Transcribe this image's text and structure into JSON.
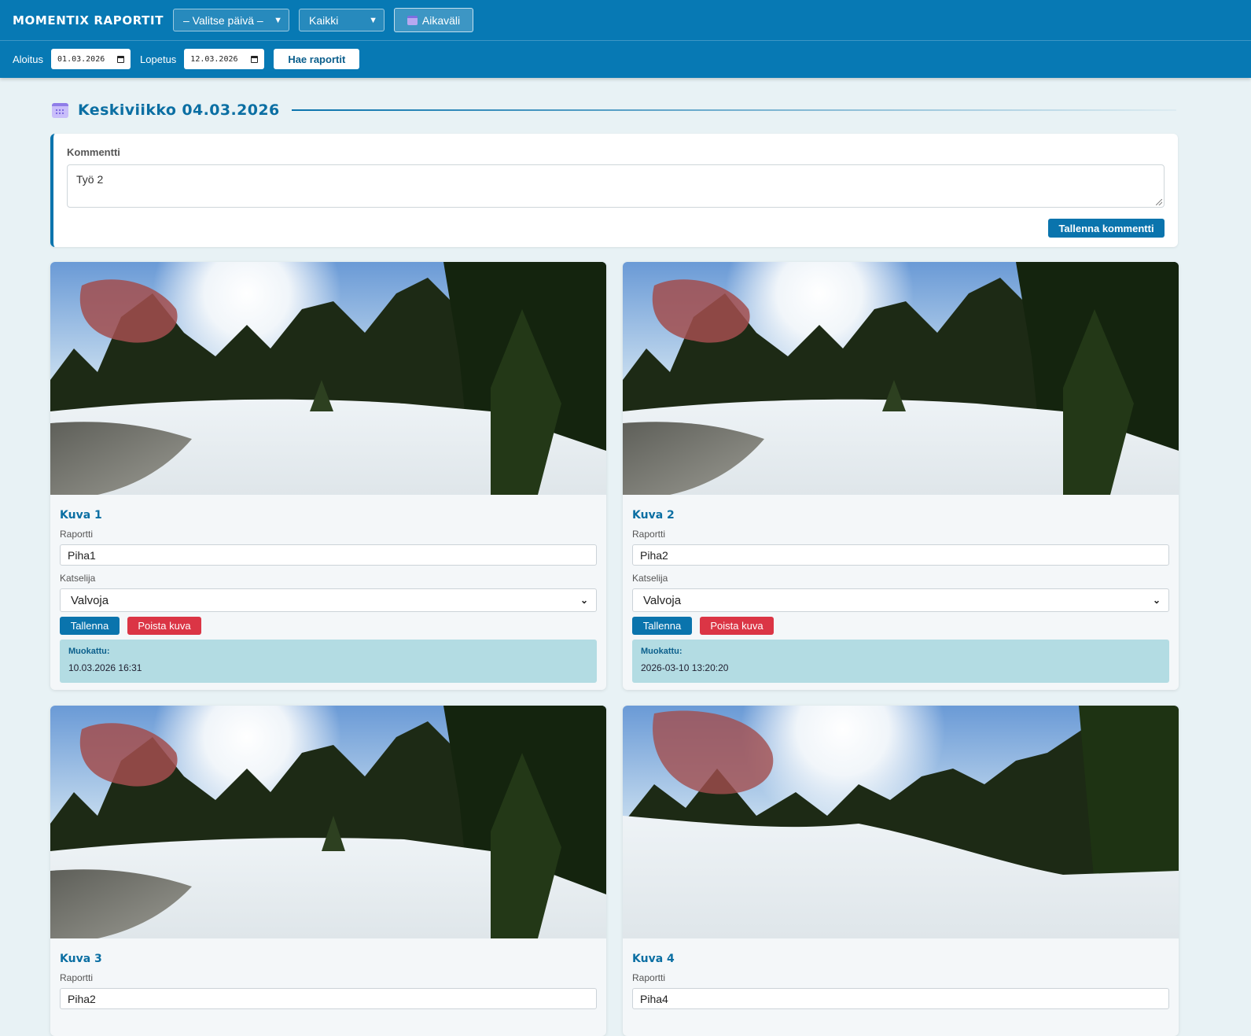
{
  "header": {
    "brand": "MOMENTIX RAPORTIT",
    "day_select": "– Valitse päivä –",
    "filter_select": "Kaikki",
    "range_button": "Aikaväli",
    "start_label": "Aloitus",
    "start_date": "01.03.2026",
    "end_label": "Lopetus",
    "end_date": "12.03.2026",
    "fetch_button": "Hae raportit"
  },
  "day": {
    "title": "Keskiviikko 04.03.2026"
  },
  "comment": {
    "label": "Kommentti",
    "value": "Työ 2",
    "save_button": "Tallenna kommentti"
  },
  "cards": [
    {
      "title": "Kuva 1",
      "report_label": "Raportti",
      "report_value": "Piha1",
      "viewer_label": "Katselija",
      "viewer_value": "Valvoja",
      "save_button": "Tallenna",
      "delete_button": "Poista kuva",
      "modified_label": "Muokattu:",
      "modified_value": "10.03.2026 16:31"
    },
    {
      "title": "Kuva 2",
      "report_label": "Raportti",
      "report_value": "Piha2",
      "viewer_label": "Katselija",
      "viewer_value": "Valvoja",
      "save_button": "Tallenna",
      "delete_button": "Poista kuva",
      "modified_label": "Muokattu:",
      "modified_value": "2026-03-10 13:20:20"
    },
    {
      "title": "Kuva 3",
      "report_label": "Raportti",
      "report_value": "Piha2"
    },
    {
      "title": "Kuva 4",
      "report_label": "Raportti",
      "report_value": "Piha4"
    }
  ],
  "colors": {
    "header_bg": "#0779b4",
    "accent": "#0a74ad",
    "danger": "#db3545",
    "modified_bg": "#b3dce3",
    "page_bg": "#e8f2f5"
  }
}
